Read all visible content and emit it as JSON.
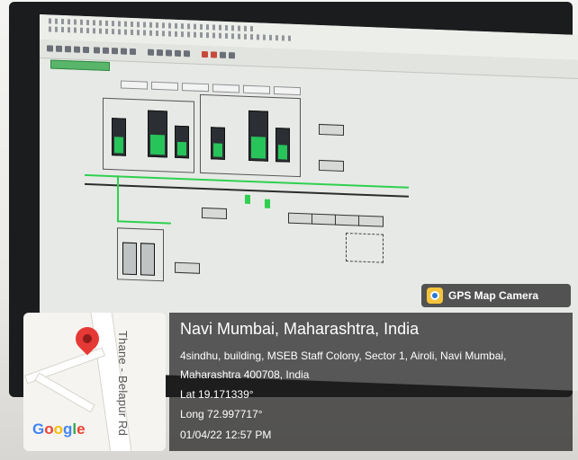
{
  "overlay": {
    "badge_label": "GPS Map Camera",
    "location_title": "Navi Mumbai, Maharashtra, India",
    "address": "4sindhu, building, MSEB Staff Colony, Sector 1, Airoli, Navi Mumbai, Maharashtra 400708, India",
    "latitude": "Lat 19.171339°",
    "longitude": "Long 72.997717°",
    "datetime": "01/04/22 12:57 PM"
  },
  "map": {
    "road_label": "Thane - Belapur Rd",
    "brand": "Google"
  },
  "colors": {
    "busbar": "#2fd04f",
    "pin": "#e53935"
  }
}
